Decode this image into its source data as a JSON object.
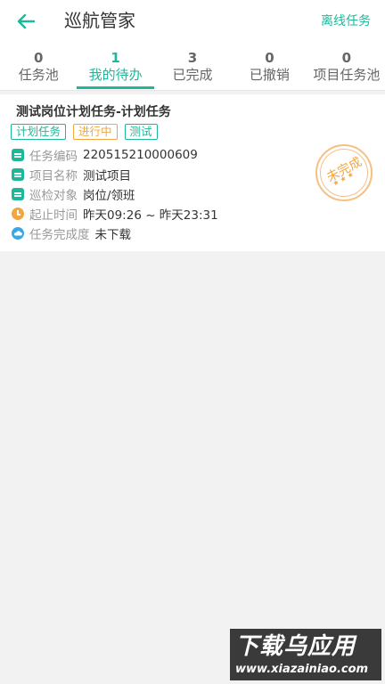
{
  "header": {
    "title": "巡航管家",
    "right_link": "离线任务"
  },
  "tabs": [
    {
      "count": "0",
      "label": "任务池"
    },
    {
      "count": "1",
      "label": "我的待办"
    },
    {
      "count": "3",
      "label": "已完成"
    },
    {
      "count": "0",
      "label": "已撤销"
    },
    {
      "count": "0",
      "label": "项目任务池"
    }
  ],
  "active_tab": 1,
  "task": {
    "title": "测试岗位计划任务-计划任务",
    "tags": [
      "计划任务",
      "进行中",
      "测试"
    ],
    "fields": [
      {
        "key": "任务编码",
        "value": "220515210000609",
        "icon": "document-icon"
      },
      {
        "key": "项目名称",
        "value": "测试项目",
        "icon": "document-icon"
      },
      {
        "key": "巡检对象",
        "value": "岗位/领班",
        "icon": "document-icon"
      },
      {
        "key": "起止时间",
        "value": "昨天09:26 ~ 昨天23:31",
        "icon": "clock-icon"
      },
      {
        "key": "任务完成度",
        "value": "未下载",
        "icon": "cloud-icon"
      }
    ],
    "stamp": "未完成"
  },
  "watermark": {
    "main": "下载乌应用",
    "sub": "www.xiazainiao.com"
  },
  "colors": {
    "accent": "#1db89a",
    "warning": "#f2a640"
  }
}
